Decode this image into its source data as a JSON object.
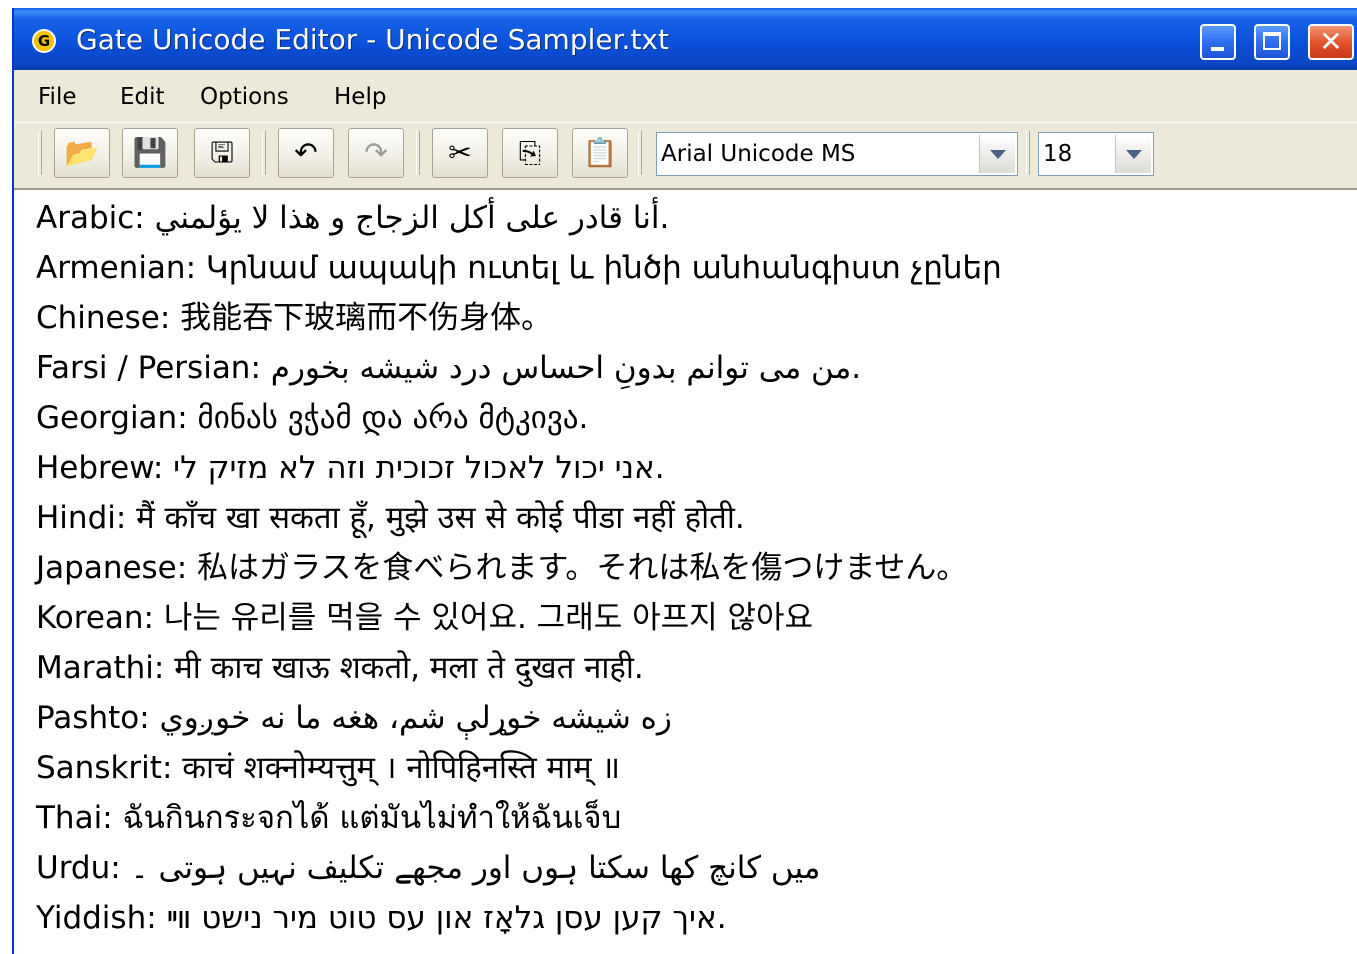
{
  "window": {
    "title": "Gate Unicode Editor - Unicode Sampler.txt",
    "app_icon_letter": "G",
    "close_glyph": "✕"
  },
  "menu": {
    "items": [
      "File",
      "Edit",
      "Options",
      "Help"
    ]
  },
  "toolbar": {
    "buttons": [
      {
        "name": "open-folder-icon",
        "glyph": "📂",
        "enabled": true
      },
      {
        "name": "save-icon",
        "glyph": "💾",
        "enabled": true
      },
      {
        "name": "save-as-icon",
        "glyph": "🖫",
        "enabled": true
      },
      {
        "name": "undo-icon",
        "glyph": "↶",
        "enabled": true
      },
      {
        "name": "redo-icon",
        "glyph": "↷",
        "enabled": false
      },
      {
        "name": "cut-icon",
        "glyph": "✂",
        "enabled": true
      },
      {
        "name": "copy-icon",
        "glyph": "⎘",
        "enabled": true
      },
      {
        "name": "paste-icon",
        "glyph": "📋",
        "enabled": true
      }
    ],
    "font_name": "Arial Unicode MS",
    "font_size": "18"
  },
  "editor": {
    "lines": [
      "Arabic: أنا قادر على أكل الزجاج و هذا لا يؤلمني.",
      "Armenian: Կրնամ ապակի ուտել և ինծի անհանգիստ չըներ",
      "Chinese: 我能吞下玻璃而不伤身体。",
      "Farsi / Persian: من می توانم بدونِ احساس درد شيشه بخورم.",
      "Georgian: მინას ვჭამ და არა მტკივა.",
      "Hebrew: אני יכול לאכול זכוכית וזה לא מזיק לי.",
      "Hindi: मैं काँच खा सकता हूँ, मुझे उस से कोई पीडा नहीं होती.",
      "Japanese: 私はガラスを食べられます。それは私を傷つけません。",
      "Korean: 나는 유리를 먹을 수 있어요. 그래도 아프지 않아요",
      "Marathi: मी काच खाऊ शकतो, मला ते दुखत नाही.",
      "Pashto: زه شيشه خوړلې شم، هغه ما نه خوږوي",
      "Sanskrit: काचं शक्नोम्यत्तुम् । नोपिहिनस्ति माम् ॥",
      "Thai: ฉันกินกระจกได้ แต่มันไม่ทำให้ฉันเจ็บ",
      "Urdu: میں کانچ کھا سکتا ہوں اور مجھے تکلیف نہیں ہوتی ۔",
      "Yiddish: איך קען עסן גלאָז און עס טוט מיר נישט װײ."
    ]
  }
}
